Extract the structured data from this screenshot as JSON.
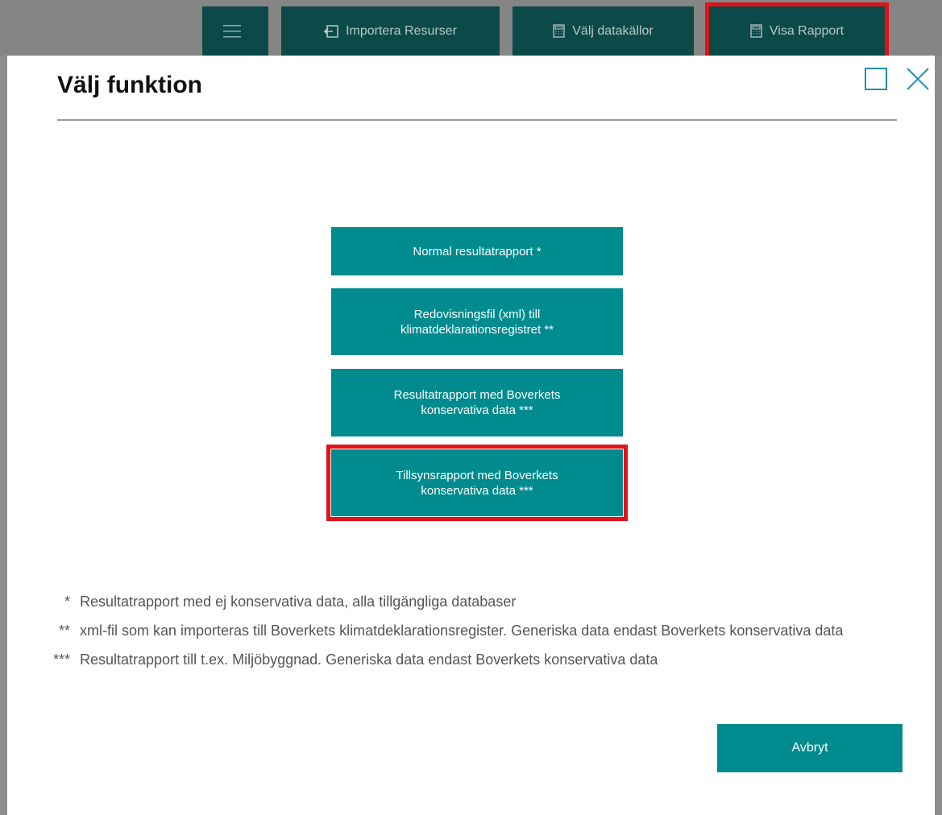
{
  "toolbar": {
    "menu_icon": "hamburger-icon",
    "import_icon": "import-icon",
    "import_label": "Importera Resurser",
    "datakallor_icon": "calculator-icon",
    "datakallor_label": "Välj datakällor",
    "rapport_icon": "calculator-icon",
    "rapport_label": "Visa Rapport",
    "highlight_color": "#e0121b"
  },
  "dialog": {
    "title": "Välj funktion",
    "maximize_icon": "maximize-icon",
    "close_icon": "close-icon",
    "choices": [
      {
        "label": "Normal resultatrapport *"
      },
      {
        "label": "Redovisningsfil (xml) till\nklimatdeklarationsregistret **"
      },
      {
        "label": "Resultatrapport med Boverkets\nkonservativa data ***"
      },
      {
        "label": "Tillsynsrapport med Boverkets\nkonservativa data ***",
        "highlighted": true
      }
    ],
    "notes": [
      {
        "mark": "*",
        "text": "Resultatrapport med ej konservativa data, alla tillgängliga databaser"
      },
      {
        "mark": "**",
        "text": "xml-fil som kan importeras till Boverkets klimatdeklarationsregister. Generiska data endast Boverkets konservativa data"
      },
      {
        "mark": "***",
        "text": "Resultatrapport till t.ex. Miljöbyggnad. Generiska data endast Boverkets konservativa data"
      }
    ],
    "cancel_label": "Avbryt"
  },
  "colors": {
    "accent": "#008b8e",
    "toolbar_button": "#0b4a49",
    "highlight": "#e0121b"
  }
}
